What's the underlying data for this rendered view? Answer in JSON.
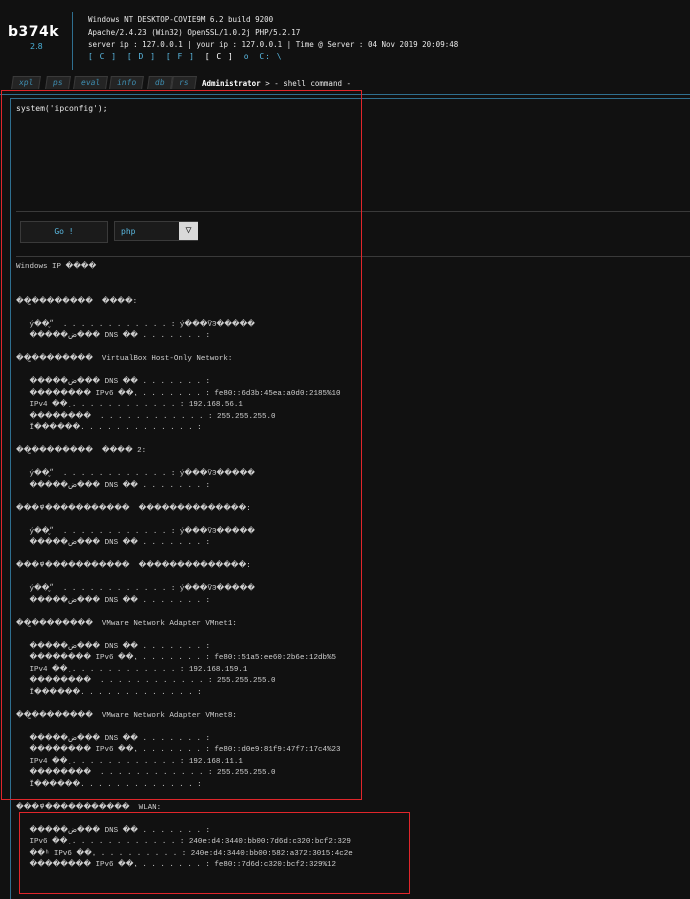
{
  "logo": {
    "name": "b374k",
    "version": "2.8"
  },
  "server_info": {
    "line1": "Windows NT DESKTOP-COVIE9M 6.2 build 9200",
    "line2": "Apache/2.4.23 (Win32) OpenSSL/1.0.2j PHP/5.2.17",
    "line3": "server ip : 127.0.0.1 | your ip : 127.0.0.1 | Time @ Server : 04 Nov 2019 20:09:48"
  },
  "drives": [
    "[ C ]",
    "[ D ]",
    "[ F ]",
    "[ C ]",
    "o",
    "C: \\"
  ],
  "tabs": [
    "xpl",
    "ps",
    "eval",
    "info",
    "db",
    "rs"
  ],
  "nav": {
    "user": "Administrator",
    "arrow": ">",
    "section": "- shell command -"
  },
  "command": {
    "text": "system('ipconfig');"
  },
  "go_button": "Go !",
  "language": {
    "selected": "php",
    "arrow": "▽"
  },
  "output": {
    "lines": [
      "Windows IP ����",
      "",
      "",
      "��̫��������  ����:",
      "",
      "   ý��״̬  . . . . . . . . . . . . : ý���ѶϿ�����",
      "   �����ض��� DNS ��׺ . . . . . . . :",
      "",
      "��̫��������  VirtualBox Host-Only Network:",
      "",
      "   �����ض��� DNS ��׺ . . . . . . . :",
      "   �������� IPv6 ��ַ. . . . . . . . : fe80::6d3b:45ea:a0d0:2185%10",
      "   IPv4 ��ַ . . . . . . . . . . . . : 192.168.56.1",
      "   ��������  . . . . . . . . . . . . : 255.255.255.0",
      "   Ĭ������. . . . . . . . . . . . . :",
      "",
      "��̫��������  ���� 2:",
      "",
      "   ý��״̬  . . . . . . . . . . . . : ý���ѶϿ�����",
      "   �����ض��� DNS ��׺ . . . . . . . :",
      "",
      "���߾�����������  ��������������:",
      "",
      "   ý��״̬  . . . . . . . . . . . . : ý���ѶϿ�����",
      "   �����ض��� DNS ��׺ . . . . . . . :",
      "",
      "���߾�����������  ��������������:",
      "",
      "   ý��״̬  . . . . . . . . . . . . : ý���ѶϿ�����",
      "   �����ض��� DNS ��׺ . . . . . . . :",
      "",
      "��̫��������  VMware Network Adapter VMnet1:",
      "",
      "   �����ض��� DNS ��׺ . . . . . . . :",
      "   �������� IPv6 ��ַ. . . . . . . . : fe80::51a5:ee60:2b6e:12db%5",
      "   IPv4 ��ַ . . . . . . . . . . . . : 192.168.159.1",
      "   ��������  . . . . . . . . . . . . : 255.255.255.0",
      "   Ĭ������. . . . . . . . . . . . . :",
      "",
      "��̫��������  VMware Network Adapter VMnet8:",
      "",
      "   �����ض��� DNS ��׺ . . . . . . . :",
      "   �������� IPv6 ��ַ. . . . . . . . : fe80::d0e9:81f9:47f7:17c4%23",
      "   IPv4 ��ַ . . . . . . . . . . . . : 192.168.11.1",
      "   ��������  . . . . . . . . . . . . : 255.255.255.0",
      "   Ĭ������. . . . . . . . . . . . . :",
      "",
      "���߾�����������  WLAN:",
      "",
      "   �����ض��� DNS ��׺ . . . . . . . :",
      "   IPv6 ��ַ . . . . . . . . . . . . : 240e:d4:3440:bb00:7d6d:c320:bcf2:329",
      "   ��ʱ IPv6 ��ַ. . . . . . . . . . : 240e:d4:3440:bb00:582:a372:3015:4c2e",
      "   �������� IPv6 ��ַ. . . . . . . . : fe80::7d6d:c320:bcf2:329%12"
    ]
  },
  "colors": {
    "accent": "#4ab0d8",
    "highlight": "#e0262b",
    "background": "#111111"
  }
}
